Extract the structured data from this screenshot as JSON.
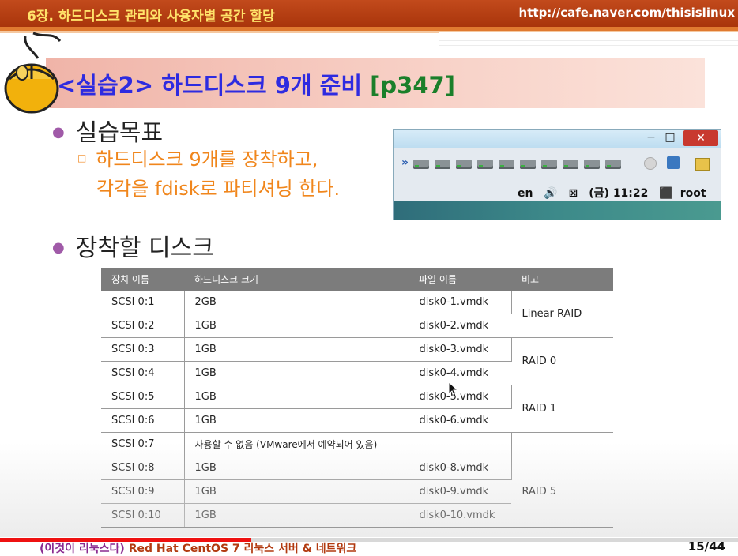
{
  "header": {
    "chapter": "6장. 하드디스크 관리와 사용자별 공간 할당",
    "url": "http://cafe.naver.com/thisislinux"
  },
  "title": {
    "main": "<실습2> 하드디스크 9개 준비",
    "page_ref": "[p347]"
  },
  "bullets": {
    "goal": "실습목표",
    "goal_detail_line1": "하드디스크 9개를 장착하고,",
    "goal_detail_line2": "각각을 fdisk로 파티셔닝 한다.",
    "disks": "장착할 디스크"
  },
  "vm_window": {
    "minimize": "−",
    "maximize": "□",
    "close": "✕",
    "status_lang": "en",
    "status_clock": "(금) 11:22",
    "status_user": "root",
    "device_count": 10
  },
  "table": {
    "headers": [
      "장치 이름",
      "하드디스크 크기",
      "파일 이름",
      "비고"
    ],
    "rows": [
      [
        "SCSI 0:1",
        "2GB",
        "disk0-1.vmdk"
      ],
      [
        "SCSI 0:2",
        "1GB",
        "disk0-2.vmdk"
      ],
      [
        "SCSI 0:3",
        "1GB",
        "disk0-3.vmdk"
      ],
      [
        "SCSI 0:4",
        "1GB",
        "disk0-4.vmdk"
      ],
      [
        "SCSI 0:5",
        "1GB",
        "disk0-5.vmdk"
      ],
      [
        "SCSI 0:6",
        "1GB",
        "disk0-6.vmdk"
      ],
      [
        "SCSI 0:7",
        "사용할 수 없음 (VMware에서 예약되어 있음)",
        ""
      ],
      [
        "SCSI 0:8",
        "1GB",
        "disk0-8.vmdk"
      ],
      [
        "SCSI 0:9",
        "1GB",
        "disk0-9.vmdk"
      ],
      [
        "SCSI 0:10",
        "1GB",
        "disk0-10.vmdk"
      ]
    ],
    "notes": {
      "linear": "Linear RAID",
      "raid0": "RAID 0",
      "raid1": "RAID 1",
      "raid5": "RAID 5"
    }
  },
  "footer": {
    "book_part1": "(이것이 리눅스다)",
    "book_part2": " Red Hat CentOS 7 리눅스 서버 & 네트워크",
    "page": "15/44",
    "video_progress": 0.34
  },
  "colors": {
    "header_bg": "#b33c10",
    "header_text": "#ffe36a",
    "title_blue": "#2e2be0",
    "title_green": "#1a7f2a",
    "sub_orange": "#f0861c",
    "table_header": "#7c7c7c"
  }
}
